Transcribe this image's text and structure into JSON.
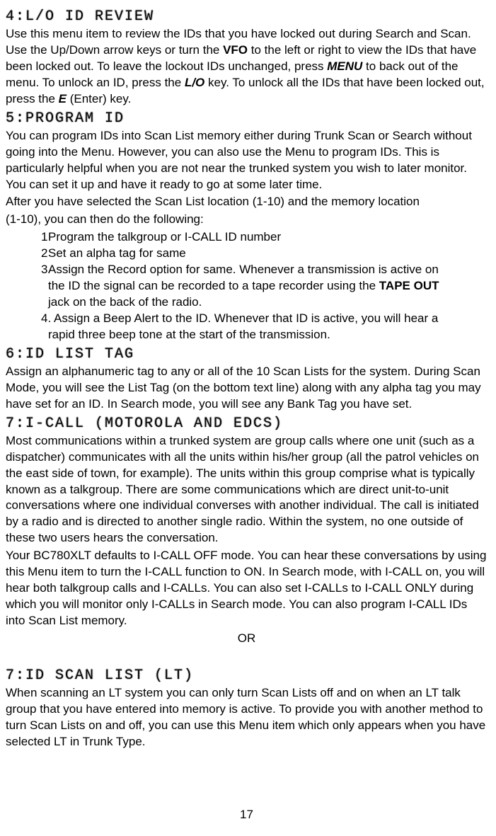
{
  "sec4": {
    "title": "4:L/O ID REVIEW",
    "p1a": "Use this menu item to review the IDs that you have locked out during Search and Scan. Use the Up/Down arrow keys or turn the ",
    "vfo": "VFO",
    "p1b": " to the left or right to view the IDs that have been locked out. To leave the lockout IDs unchanged, press ",
    "menu": "MENU",
    "p1c": " to back out of the menu. To unlock an ID, press the ",
    "lo": "L/O",
    "p1d": " key. To unlock all the IDs that have been locked out, press the ",
    "e": "E",
    "p1e": " (Enter) key."
  },
  "sec5": {
    "title": "5:PROGRAM ID",
    "p1": "You can program IDs into Scan List memory either during Trunk Scan or Search without going into the Menu. However, you can also use the Menu to program IDs. This is particularly helpful when you are not near the trunked system you wish to later monitor. You can set it up and have it ready to go at some later time.",
    "p2": "After you have selected the Scan List location (1-10) and the memory location",
    "p3": "(1-10), you can then do the following:",
    "li1n": "1",
    "li1": "Program the talkgroup or I-CALL ID number",
    "li2n": "2",
    "li2": "Set an alpha tag for same",
    "li3n": "3",
    "li3a": "Assign the Record option for same. Whenever a transmission is active on",
    "li3b": "the ID the signal can be recorded to a tape recorder using the ",
    "tapeout": "TAPE OUT",
    "li3c": "jack on the back of the radio.",
    "li4n": "4.",
    "li4a": "Assign a Beep Alert to the ID. Whenever that ID is active, you will hear a",
    "li4b": "rapid three beep tone at the start of the transmission."
  },
  "sec6": {
    "title": "6:ID LIST TAG",
    "p1": "Assign an alphanumeric tag to any or all of the 10 Scan Lists for the system. During Scan Mode, you will see the List Tag (on the bottom text line) along with any alpha tag you may have set for an ID. In Search mode, you will see any Bank Tag you have set."
  },
  "sec7a": {
    "title": "7:I-CALL (MOTOROLA AND EDCS)",
    "p1": "Most communications within a trunked system are group calls where one unit (such as a dispatcher) communicates with all the units within his/her group (all the patrol vehicles on the east side of town, for example). The units within this group comprise what is typically known as a talkgroup. There are some communications which are direct unit-to-unit conversations where one individual converses with another individual. The call is initiated by a radio and is directed to another single radio. Within the system, no one outside of these two users hears the conversation.",
    "p2": "Your BC780XLT defaults to I-CALL OFF mode. You can hear these conversations by using this Menu item to turn the I-CALL function to ON. In Search mode, with I-CALL on, you will hear both talkgroup calls and I-CALLs. You can also set I-CALLs to I-CALL ONLY during which you will monitor only I-CALLs in Search mode. You can also program I-CALL IDs into Scan List memory.",
    "or": "OR"
  },
  "sec7b": {
    "title": "7:ID SCAN LIST (LT)",
    "p1": "When scanning an LT system you can only turn Scan Lists off and on when an LT talk group that you have entered into memory is active. To provide you with another method to turn Scan Lists on and off, you can use this Menu item which only appears when you have selected LT in Trunk Type."
  },
  "page": "17"
}
